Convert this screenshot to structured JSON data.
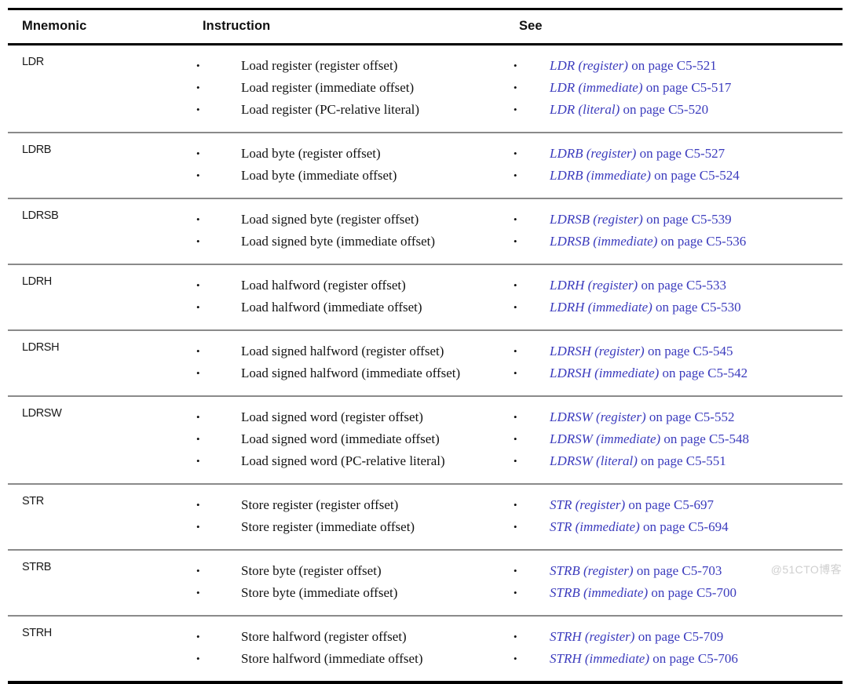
{
  "table": {
    "columns": [
      "Mnemonic",
      "Instruction",
      "See"
    ],
    "rows": [
      {
        "mnemonic": "LDR",
        "instructions": [
          "Load register (register offset)",
          "Load register (immediate offset)",
          "Load register (PC-relative literal)"
        ],
        "see": [
          {
            "title": "LDR (register)",
            "tail": " on page C5-521"
          },
          {
            "title": "LDR (immediate)",
            "tail": " on page C5-517"
          },
          {
            "title": "LDR (literal)",
            "tail": " on page C5-520"
          }
        ]
      },
      {
        "mnemonic": "LDRB",
        "instructions": [
          "Load byte (register offset)",
          "Load byte (immediate offset)"
        ],
        "see": [
          {
            "title": "LDRB (register)",
            "tail": " on page C5-527"
          },
          {
            "title": "LDRB (immediate)",
            "tail": " on page C5-524"
          }
        ]
      },
      {
        "mnemonic": "LDRSB",
        "instructions": [
          "Load signed byte (register offset)",
          "Load signed byte (immediate offset)"
        ],
        "see": [
          {
            "title": "LDRSB (register)",
            "tail": " on page C5-539"
          },
          {
            "title": "LDRSB (immediate)",
            "tail": " on page C5-536"
          }
        ]
      },
      {
        "mnemonic": "LDRH",
        "instructions": [
          "Load halfword (register offset)",
          "Load halfword (immediate offset)"
        ],
        "see": [
          {
            "title": "LDRH (register)",
            "tail": " on page C5-533"
          },
          {
            "title": "LDRH (immediate)",
            "tail": " on page C5-530"
          }
        ]
      },
      {
        "mnemonic": "LDRSH",
        "instructions": [
          "Load signed halfword (register offset)",
          "Load signed halfword (immediate offset)"
        ],
        "see": [
          {
            "title": "LDRSH (register)",
            "tail": " on page C5-545"
          },
          {
            "title": "LDRSH (immediate)",
            "tail": " on page C5-542"
          }
        ]
      },
      {
        "mnemonic": "LDRSW",
        "instructions": [
          "Load signed word (register offset)",
          "Load signed word (immediate offset)",
          "Load signed word (PC-relative literal)"
        ],
        "see": [
          {
            "title": "LDRSW (register)",
            "tail": " on page C5-552"
          },
          {
            "title": "LDRSW (immediate)",
            "tail": " on page C5-548"
          },
          {
            "title": "LDRSW (literal)",
            "tail": " on page C5-551"
          }
        ]
      },
      {
        "mnemonic": "STR",
        "instructions": [
          "Store register (register offset)",
          "Store register (immediate offset)"
        ],
        "see": [
          {
            "title": "STR (register)",
            "tail": " on page C5-697"
          },
          {
            "title": "STR (immediate)",
            "tail": " on page C5-694"
          }
        ]
      },
      {
        "mnemonic": "STRB",
        "instructions": [
          "Store byte (register offset)",
          "Store byte (immediate offset)"
        ],
        "see": [
          {
            "title": "STRB (register)",
            "tail": " on page C5-703"
          },
          {
            "title": "STRB (immediate)",
            "tail": " on page C5-700"
          }
        ]
      },
      {
        "mnemonic": "STRH",
        "instructions": [
          "Store halfword (register offset)",
          "Store halfword (immediate offset)"
        ],
        "see": [
          {
            "title": "STRH (register)",
            "tail": " on page C5-709"
          },
          {
            "title": "STRH (immediate)",
            "tail": " on page C5-706"
          }
        ]
      }
    ]
  },
  "watermark": "@51CTO博客",
  "colors": {
    "link": "#3b3bbd",
    "rule_strong": "#000000",
    "rule_light": "#8a8a8a",
    "text": "#121212"
  }
}
